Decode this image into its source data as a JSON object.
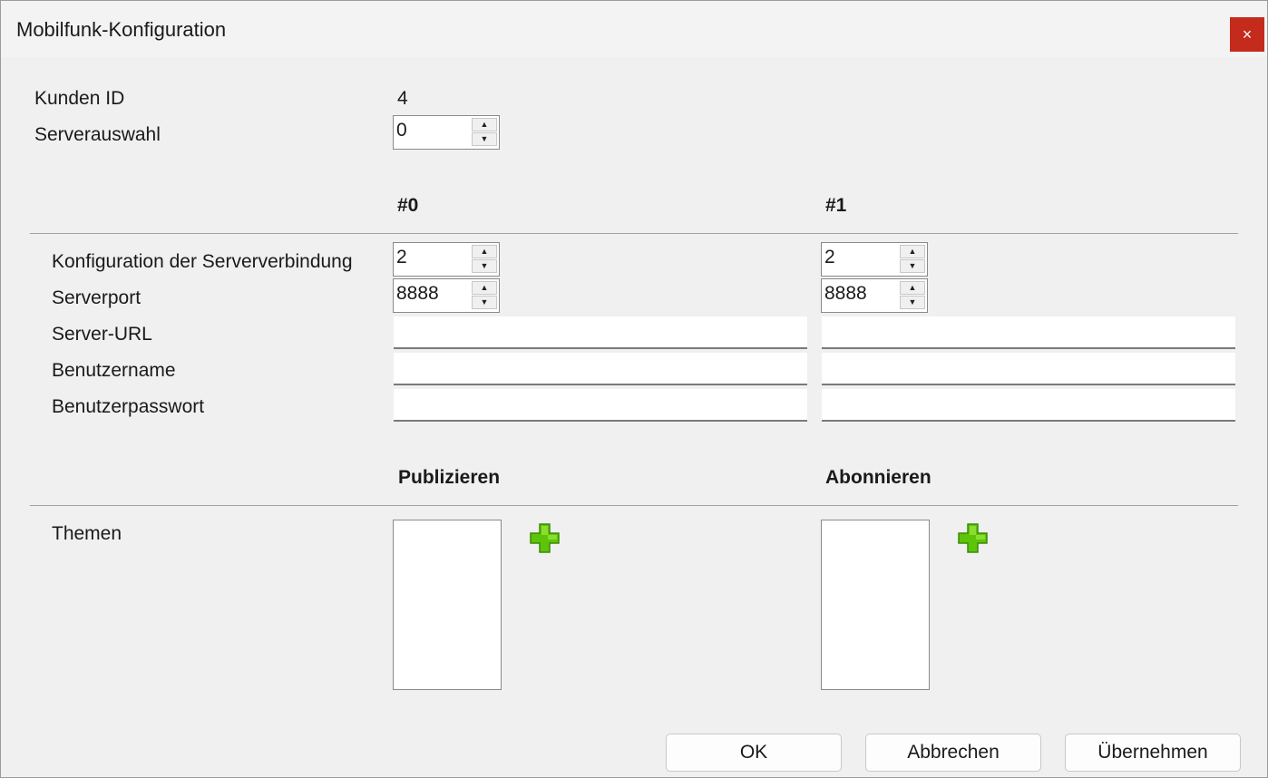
{
  "window": {
    "title": "Mobilfunk-Konfiguration",
    "close_label": "×"
  },
  "customer": {
    "label": "Kunden ID",
    "value": "4"
  },
  "server_selection": {
    "label": "Serverauswahl",
    "value": "0"
  },
  "columns": {
    "col0": "#0",
    "col1": "#1"
  },
  "fields": {
    "connection_config": {
      "label": "Konfiguration der Serververbindung",
      "values": [
        "2",
        "2"
      ]
    },
    "server_port": {
      "label": "Serverport",
      "values": [
        "8888",
        "8888"
      ]
    },
    "server_url": {
      "label": "Server-URL",
      "values": [
        "",
        ""
      ]
    },
    "username": {
      "label": "Benutzername",
      "values": [
        "",
        ""
      ]
    },
    "password": {
      "label": "Benutzerpasswort",
      "values": [
        "",
        ""
      ]
    }
  },
  "topics": {
    "publish_header": "Publizieren",
    "subscribe_header": "Abonnieren",
    "label": "Themen",
    "publish_items": [],
    "subscribe_items": []
  },
  "buttons": {
    "ok": "OK",
    "cancel": "Abbrechen",
    "apply": "Übernehmen"
  },
  "icons": {
    "add": "plus-icon",
    "add_color": "#5ec40a",
    "close_bg": "#c42b1c"
  }
}
